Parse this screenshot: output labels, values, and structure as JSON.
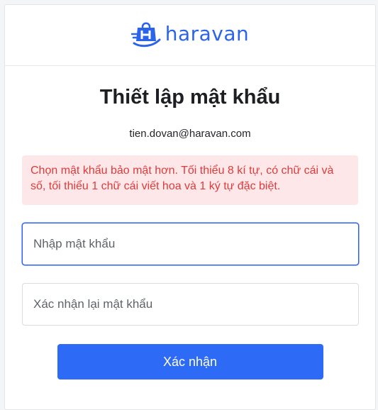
{
  "brand": {
    "name": "haravan",
    "logo_icon": "shopping-bag-h-icon",
    "color": "#2b63ea"
  },
  "page": {
    "title": "Thiết lập mật khẩu",
    "email": "tien.dovan@haravan.com"
  },
  "alert": {
    "message": "Chọn mật khẩu bảo mật hơn. Tối thiểu 8 kí tự, có chữ cái và số, tối thiểu 1 chữ cái viết hoa và 1 ký tự đặc biệt.",
    "background": "#fde7e8",
    "text_color": "#e03a3a"
  },
  "form": {
    "password_placeholder": "Nhập mật khẩu",
    "password_value": "",
    "confirm_placeholder": "Xác nhận lại mật khẩu",
    "confirm_value": "",
    "submit_label": "Xác nhận",
    "submit_color": "#2d6af6",
    "focus_color": "#2b5ff0"
  }
}
